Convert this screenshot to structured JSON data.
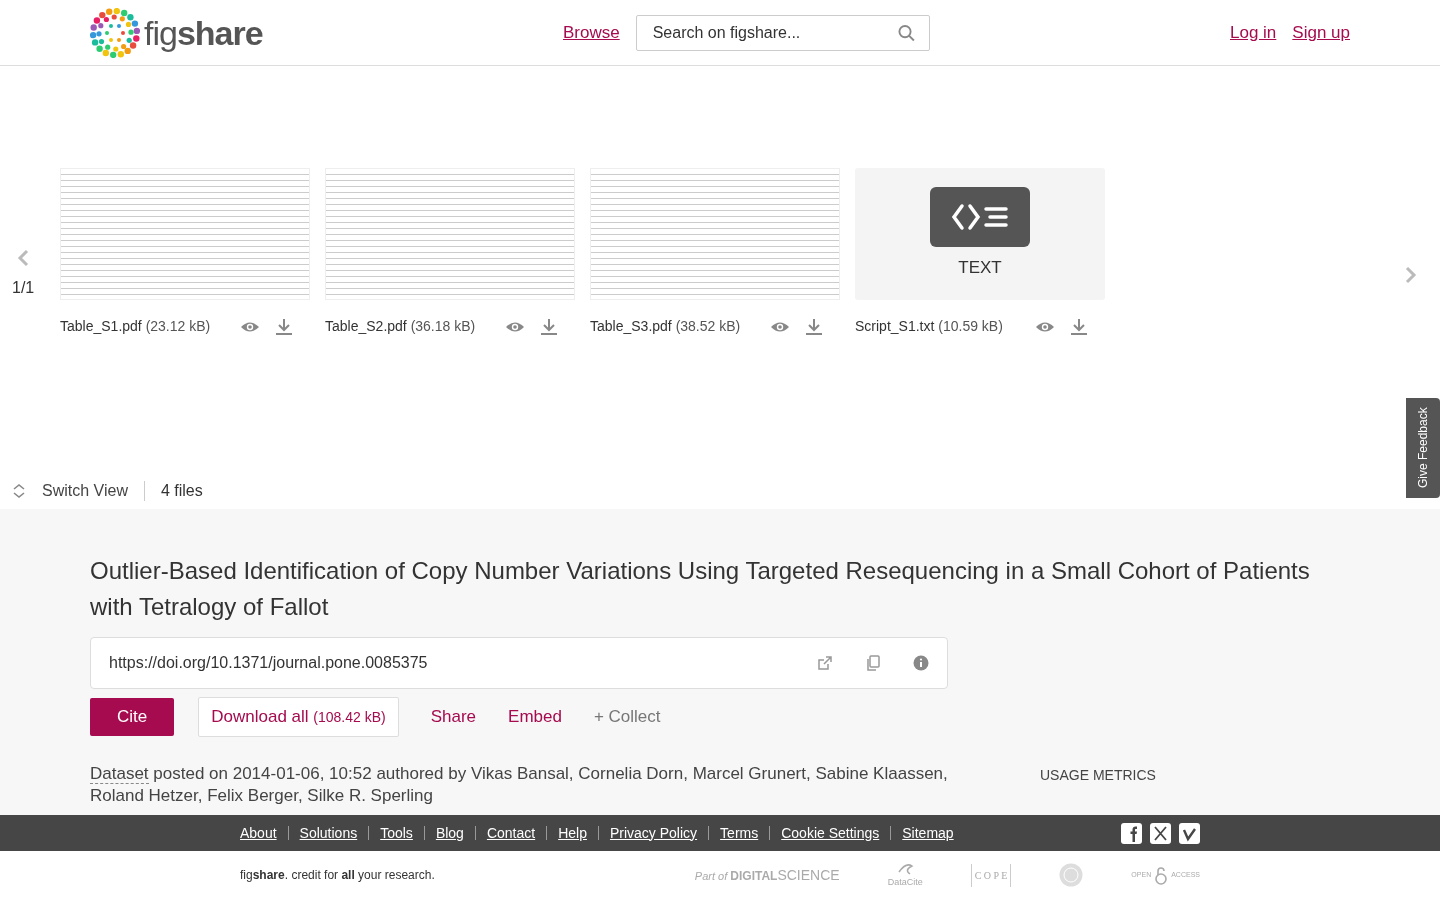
{
  "header": {
    "logo": "fig**share**",
    "browse": "Browse",
    "search": {
      "placeholder": "Search on figshare..."
    },
    "auth": [
      "Log in",
      "Sign up"
    ]
  },
  "carousel": {
    "page": "1/1",
    "files": [
      {
        "name": "Table_S1.pdf",
        "size": "(23.12 kB)",
        "kind": "document"
      },
      {
        "name": "Table_S2.pdf",
        "size": "(36.18 kB)",
        "kind": "document"
      },
      {
        "name": "Table_S3.pdf",
        "size": "(38.52 kB)",
        "kind": "document"
      },
      {
        "name": "Script_S1.txt",
        "size": "(10.59 kB)",
        "kind": "text",
        "type_label": "TEXT"
      }
    ]
  },
  "view_bar": {
    "switch_view": "Switch View",
    "file_count": "4 files"
  },
  "feedback": "Give Feedback",
  "item": {
    "title": "Outlier-Based Identification of Copy Number Variations Using Targeted Resequencing in a Small Cohort of Patients with Tetralogy of Fallot",
    "doi": "https://doi.org/10.1371/journal.pone.0085375",
    "actions": {
      "cite": "Cite",
      "download_all": "Download all",
      "download_size": "(108.42 kB)",
      "share": "Share",
      "embed": "Embed",
      "collect": "+ Collect"
    },
    "meta": {
      "type": "Dataset",
      "text": "posted on 2014-01-06, 10:52 authored by Vikas Bansal, Cornelia Dorn, Marcel Grunert, Sabine Klaassen, Roland Hetzer, Felix Berger, Silke R. Sperling"
    },
    "usage_metrics": "USAGE METRICS"
  },
  "footer": {
    "links": [
      "About",
      "Solutions",
      "Tools",
      "Blog",
      "Contact",
      "Help",
      "Privacy Policy",
      "Terms",
      "Cookie Settings",
      "Sitemap"
    ],
    "tagline": "fig**share**. credit for **all** your research.",
    "partners": [
      {
        "kind": "digital_science",
        "prefix": "Part of",
        "name": "DIGITAL",
        "suffix": "SCIENCE"
      },
      {
        "kind": "datacite",
        "name": "DataCite"
      },
      {
        "kind": "cope",
        "name": "C O P E"
      },
      {
        "kind": "seal"
      },
      {
        "kind": "open_access",
        "name": "OPEN",
        "suffix": "ACCESS"
      }
    ]
  }
}
